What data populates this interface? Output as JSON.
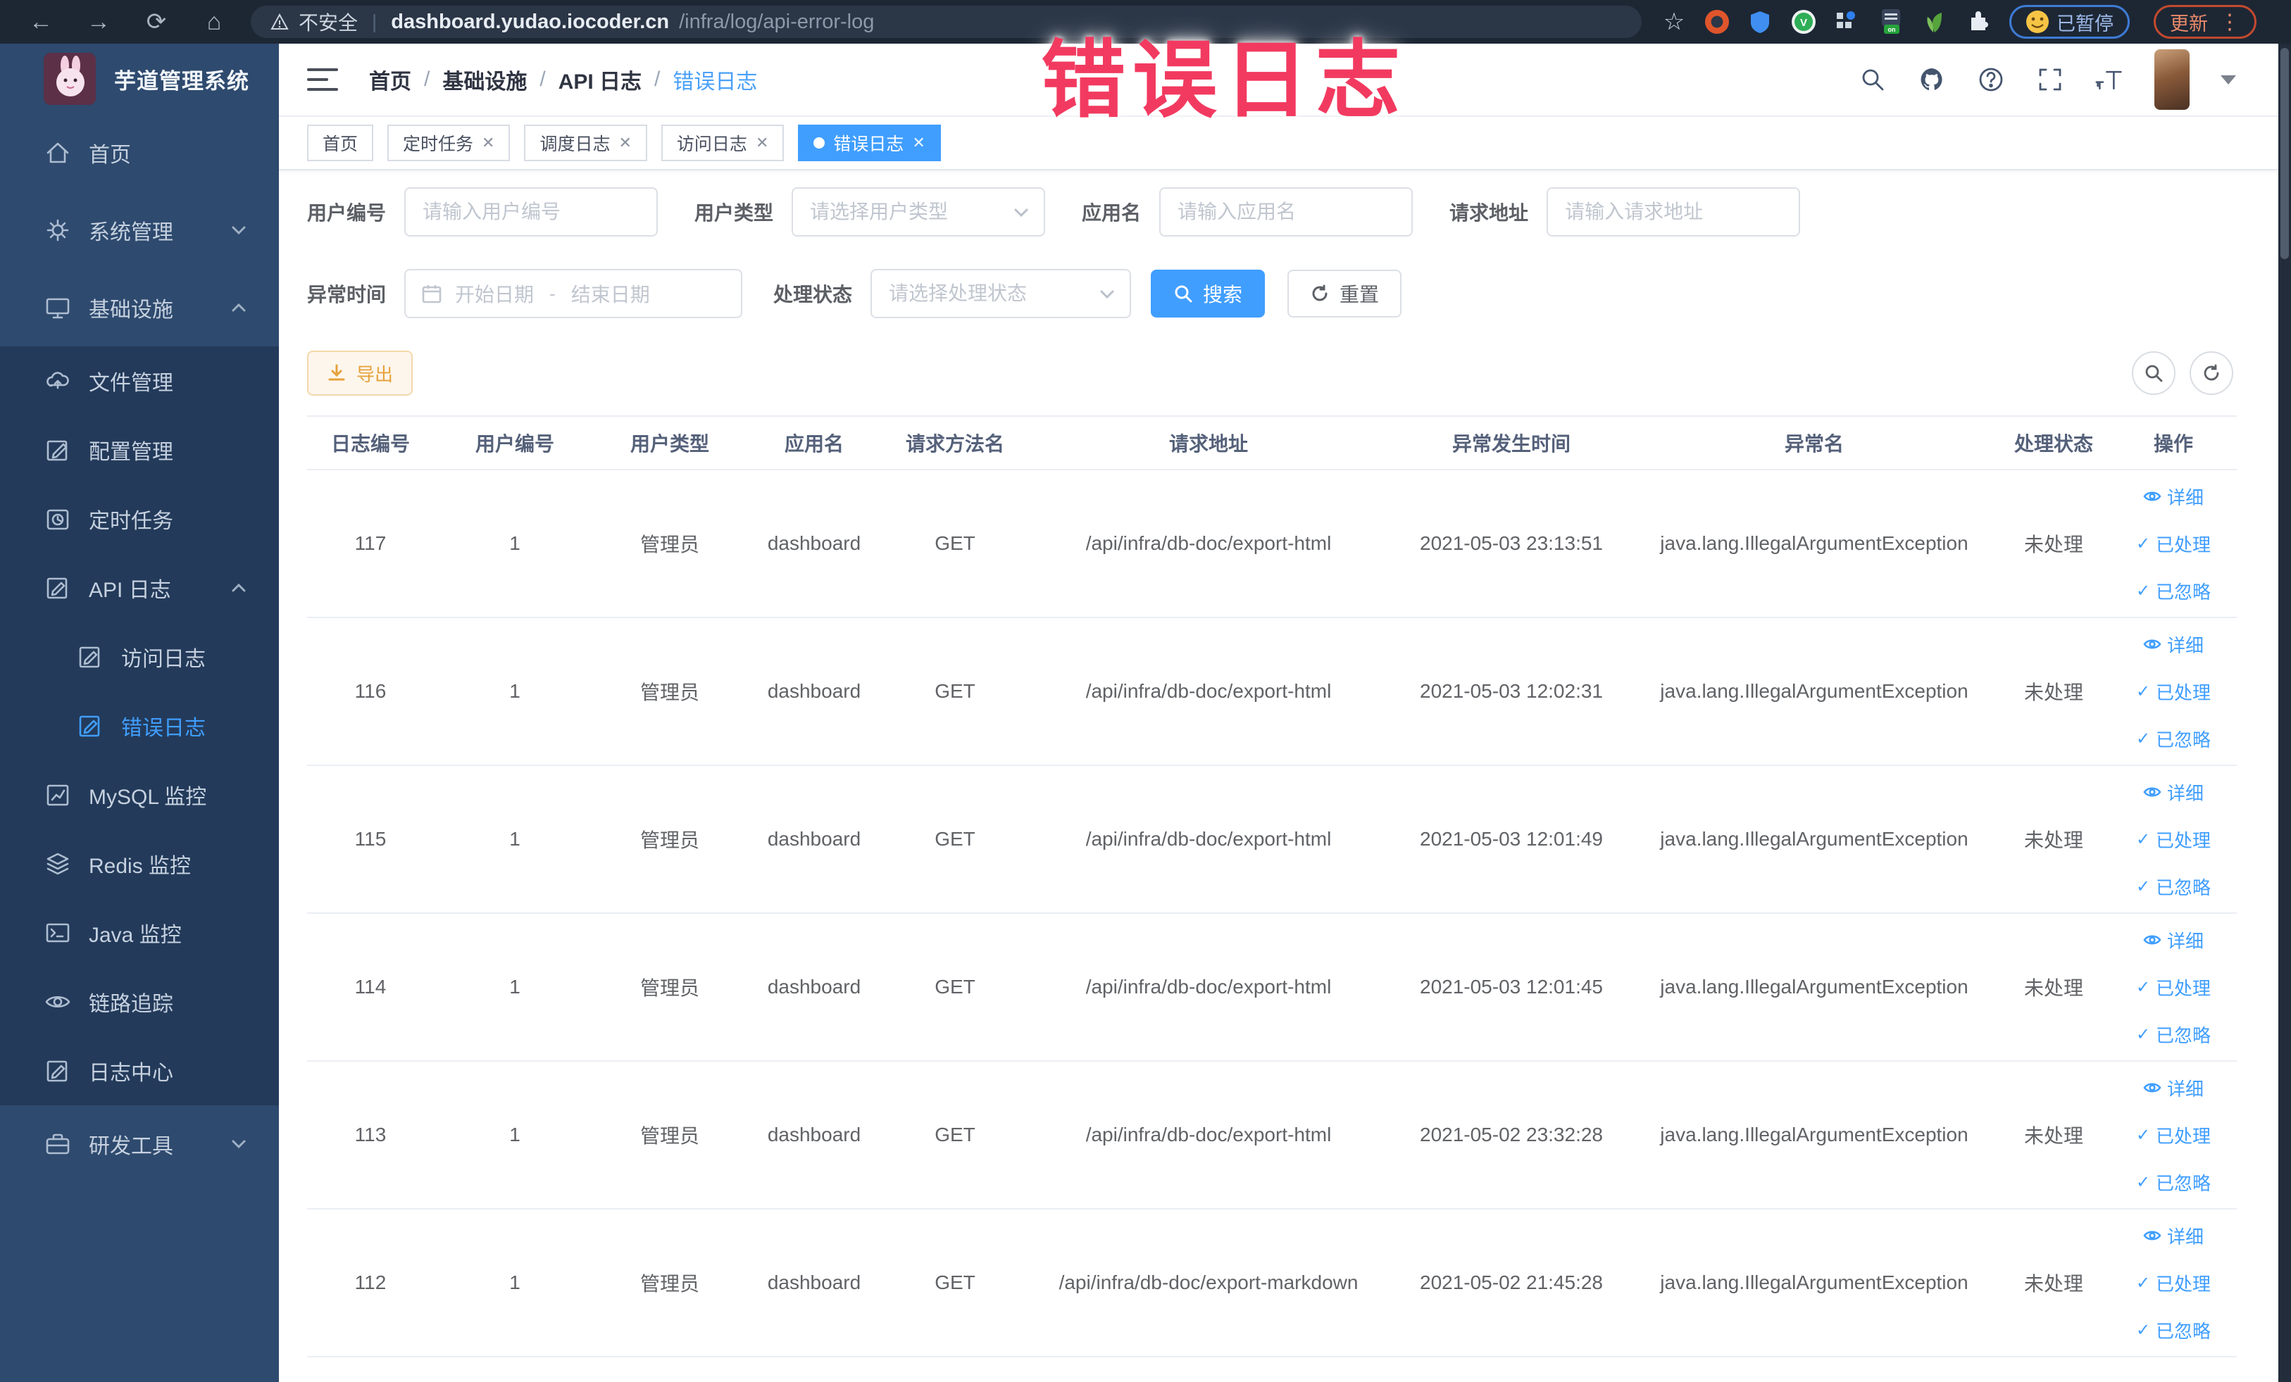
{
  "browser": {
    "security_label": "不安全",
    "url_host": "dashboard.yudao.iocoder.cn",
    "url_path": "/infra/log/api-error-log",
    "paused_label": "已暂停",
    "update_label": "更新"
  },
  "watermark": "错误日志",
  "sidebar": {
    "app_title": "芋道管理系统",
    "items": [
      {
        "label": "首页"
      },
      {
        "label": "系统管理"
      },
      {
        "label": "基础设施"
      },
      {
        "label": "文件管理"
      },
      {
        "label": "配置管理"
      },
      {
        "label": "定时任务"
      },
      {
        "label": "API 日志"
      },
      {
        "label": "访问日志"
      },
      {
        "label": "错误日志"
      },
      {
        "label": "MySQL 监控"
      },
      {
        "label": "Redis 监控"
      },
      {
        "label": "Java 监控"
      },
      {
        "label": "链路追踪"
      },
      {
        "label": "日志中心"
      },
      {
        "label": "研发工具"
      }
    ]
  },
  "header": {
    "breadcrumb": [
      "首页",
      "基础设施",
      "API 日志",
      "错误日志"
    ],
    "separator": "/"
  },
  "tags": [
    {
      "label": "首页"
    },
    {
      "label": "定时任务"
    },
    {
      "label": "调度日志"
    },
    {
      "label": "访问日志"
    },
    {
      "label": "错误日志"
    }
  ],
  "filters": {
    "user_id_label": "用户编号",
    "user_id_placeholder": "请输入用户编号",
    "user_type_label": "用户类型",
    "user_type_placeholder": "请选择用户类型",
    "app_name_label": "应用名",
    "app_name_placeholder": "请输入应用名",
    "request_url_label": "请求地址",
    "request_url_placeholder": "请输入请求地址",
    "exception_time_label": "异常时间",
    "date_start_placeholder": "开始日期",
    "date_separator": "-",
    "date_end_placeholder": "结束日期",
    "process_status_label": "处理状态",
    "process_status_placeholder": "请选择处理状态",
    "search_label": "搜索",
    "reset_label": "重置"
  },
  "toolbar": {
    "export_label": "导出"
  },
  "table": {
    "headers": [
      "日志编号",
      "用户编号",
      "用户类型",
      "应用名",
      "请求方法名",
      "请求地址",
      "异常发生时间",
      "异常名",
      "处理状态",
      "操作"
    ],
    "action_labels": {
      "detail": "详细",
      "processed": "已处理",
      "ignored": "已忽略"
    },
    "rows": [
      {
        "id": "117",
        "user_id": "1",
        "user_type": "管理员",
        "app_name": "dashboard",
        "method": "GET",
        "url": "/api/infra/db-doc/export-html",
        "time": "2021-05-03 23:13:51",
        "exception": "java.lang.IllegalArgumentException",
        "status": "未处理"
      },
      {
        "id": "116",
        "user_id": "1",
        "user_type": "管理员",
        "app_name": "dashboard",
        "method": "GET",
        "url": "/api/infra/db-doc/export-html",
        "time": "2021-05-03 12:02:31",
        "exception": "java.lang.IllegalArgumentException",
        "status": "未处理"
      },
      {
        "id": "115",
        "user_id": "1",
        "user_type": "管理员",
        "app_name": "dashboard",
        "method": "GET",
        "url": "/api/infra/db-doc/export-html",
        "time": "2021-05-03 12:01:49",
        "exception": "java.lang.IllegalArgumentException",
        "status": "未处理"
      },
      {
        "id": "114",
        "user_id": "1",
        "user_type": "管理员",
        "app_name": "dashboard",
        "method": "GET",
        "url": "/api/infra/db-doc/export-html",
        "time": "2021-05-03 12:01:45",
        "exception": "java.lang.IllegalArgumentException",
        "status": "未处理"
      },
      {
        "id": "113",
        "user_id": "1",
        "user_type": "管理员",
        "app_name": "dashboard",
        "method": "GET",
        "url": "/api/infra/db-doc/export-html",
        "time": "2021-05-02 23:32:28",
        "exception": "java.lang.IllegalArgumentException",
        "status": "未处理"
      },
      {
        "id": "112",
        "user_id": "1",
        "user_type": "管理员",
        "app_name": "dashboard",
        "method": "GET",
        "url": "/api/infra/db-doc/export-markdown",
        "time": "2021-05-02 21:45:28",
        "exception": "java.lang.IllegalArgumentException",
        "status": "未处理"
      }
    ]
  },
  "colors": {
    "accent": "#409eff",
    "warning": "#e6a23c",
    "watermark_pink": "#f23a60",
    "sidebar_bg": "#2e4a6e",
    "submenu_bg": "#233a5a"
  }
}
